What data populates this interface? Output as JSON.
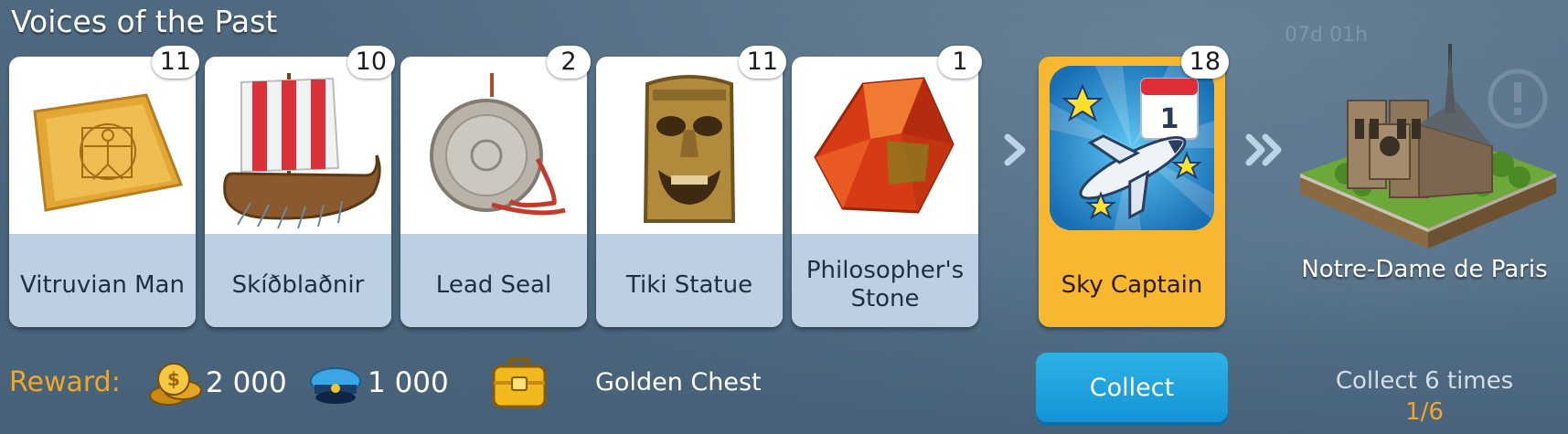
{
  "title": "Voices of the Past",
  "items": [
    {
      "label": "Vitruvian Man",
      "count": "11",
      "icon": "parchment-icon"
    },
    {
      "label": "Skíðblaðnir",
      "count": "10",
      "icon": "viking-ship-icon"
    },
    {
      "label": "Lead Seal",
      "count": "2",
      "icon": "lead-seal-icon"
    },
    {
      "label": "Tiki Statue",
      "count": "11",
      "icon": "tiki-statue-icon"
    },
    {
      "label": "Philosopher's Stone",
      "count": "1",
      "icon": "red-crystal-icon"
    }
  ],
  "badge": {
    "label": "Sky Captain",
    "count": "18",
    "calendar_day": "1",
    "icon": "airplane-badge-icon"
  },
  "landmark": {
    "label": "Notre-Dame de Paris",
    "icon": "notre-dame-icon"
  },
  "reward": {
    "label": "Reward:",
    "coins": "2 000",
    "caps": "1 000",
    "chest": "Golden Chest"
  },
  "collect_button": "Collect",
  "progress": {
    "text": "Collect 6 times",
    "count": "1/6",
    "done": 1,
    "total": 6
  },
  "background_text": {
    "timer": "07d 01h"
  },
  "colors": {
    "accent_orange": "#f3a623",
    "badge_gold": "#f7b730",
    "button_blue": "#1494d6",
    "label_blue": "#bdd0e3"
  }
}
